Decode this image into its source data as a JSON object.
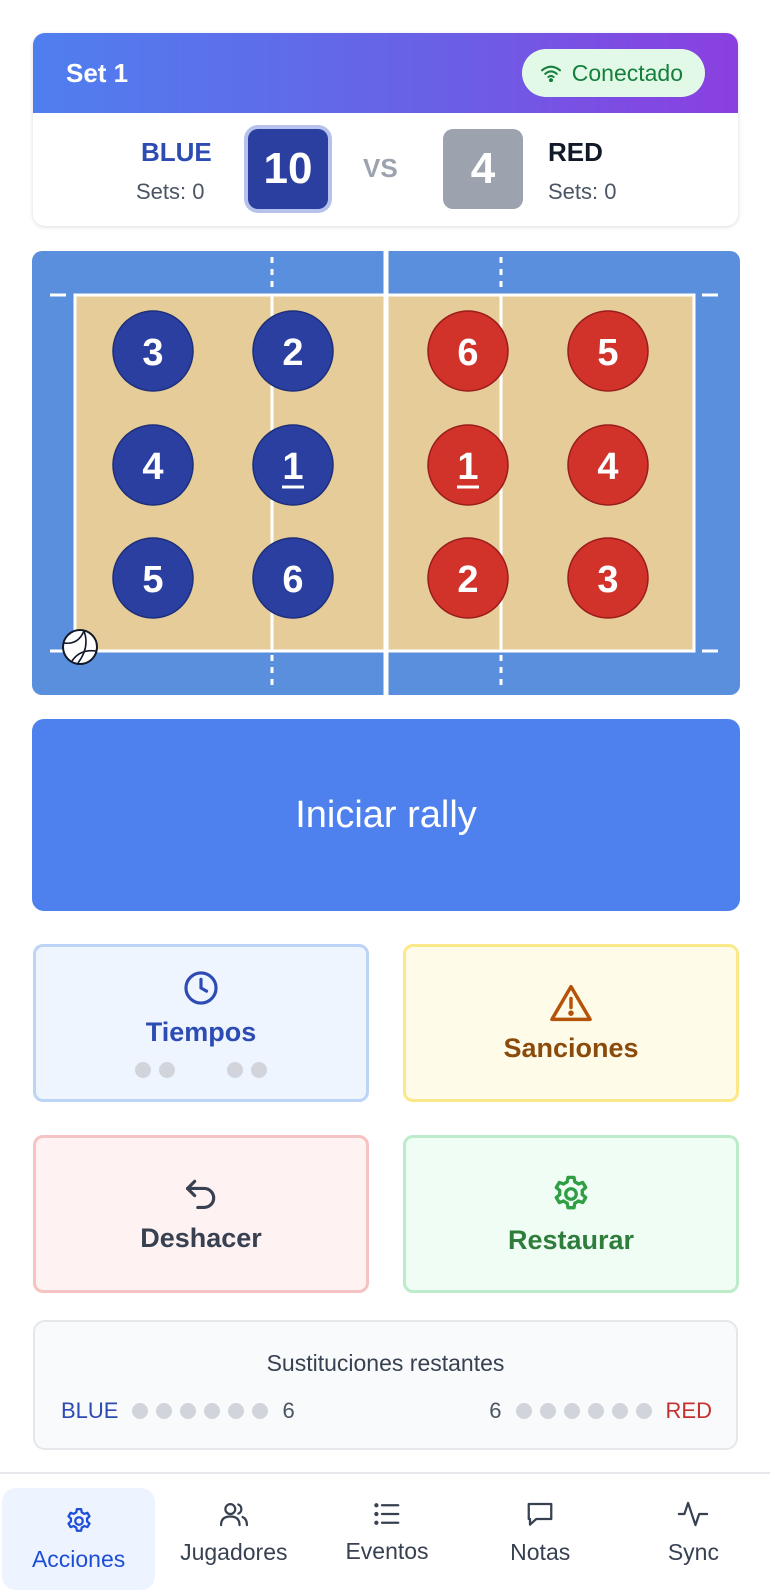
{
  "header": {
    "set_label": "Set 1",
    "status": "Conectado"
  },
  "score": {
    "blue": {
      "name": "BLUE",
      "sets": "Sets: 0",
      "points": "10"
    },
    "red": {
      "name": "RED",
      "sets": "Sets: 0",
      "points": "4"
    },
    "vs": "VS"
  },
  "court": {
    "blue_players": [
      [
        "3",
        "2"
      ],
      [
        "4",
        "1"
      ],
      [
        "5",
        "6"
      ]
    ],
    "red_players": [
      [
        "6",
        "5"
      ],
      [
        "1",
        "4"
      ],
      [
        "2",
        "3"
      ]
    ],
    "blue_color": "#2a3f9f",
    "red_color": "#d1332b"
  },
  "rally_button": "Iniciar rally",
  "actions": {
    "tiempos": "Tiempos",
    "sanciones": "Sanciones",
    "deshacer": "Deshacer",
    "restaurar": "Restaurar"
  },
  "substitutions": {
    "title": "Sustituciones restantes",
    "blue_label": "BLUE",
    "blue_count": "6",
    "red_label": "RED",
    "red_count": "6"
  },
  "nav": {
    "acciones": "Acciones",
    "jugadores": "Jugadores",
    "eventos": "Eventos",
    "notas": "Notas",
    "sync": "Sync"
  },
  "colors": {
    "accent": "#4f81ee",
    "court_floor": "#e5cc98",
    "court_surround": "#5a8fdd"
  }
}
